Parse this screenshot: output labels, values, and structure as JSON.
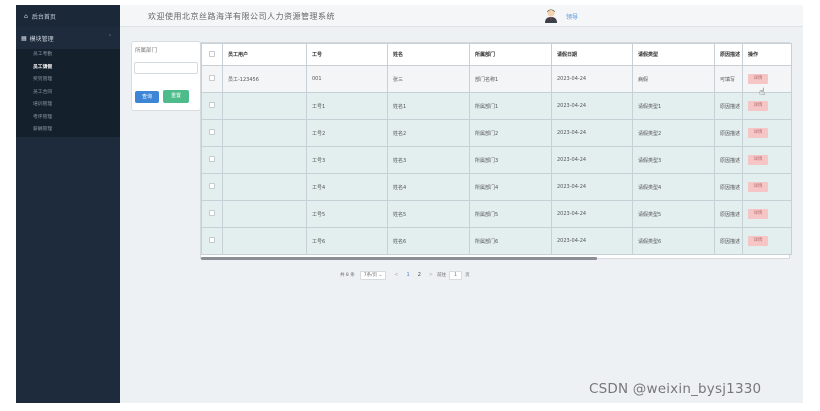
{
  "sidebar": {
    "home": "后台首页",
    "group": "模块管理",
    "items": [
      {
        "label": "员工考勤"
      },
      {
        "label": "员工请假"
      },
      {
        "label": "奖罚管理"
      },
      {
        "label": "员工合同"
      },
      {
        "label": "培训管理"
      },
      {
        "label": "考评管理"
      },
      {
        "label": "薪酬管理"
      }
    ]
  },
  "header": {
    "title": "欢迎使用北京丝路海洋有限公司人力资源管理系统",
    "role": "领导"
  },
  "search": {
    "label": "所属部门",
    "query_button": "查询",
    "reset_button": "重置"
  },
  "table": {
    "columns": [
      "员工用户",
      "工号",
      "姓名",
      "所属部门",
      "请假日期",
      "请假类型",
      "原因描述",
      "操作"
    ],
    "rows": [
      {
        "user": "员工-123456",
        "id": "001",
        "name": "张三",
        "dept": "部门名称1",
        "date": "2023-04-24",
        "type": "病假",
        "reason": "可填写",
        "action": "详情"
      },
      {
        "user": "",
        "id": "工号1",
        "name": "姓名1",
        "dept": "所属部门1",
        "date": "2023-04-24",
        "type": "请假类型1",
        "reason": "原因描述",
        "action": "详情"
      },
      {
        "user": "",
        "id": "工号2",
        "name": "姓名2",
        "dept": "所属部门2",
        "date": "2023-04-24",
        "type": "请假类型2",
        "reason": "原因描述",
        "action": "详情"
      },
      {
        "user": "",
        "id": "工号3",
        "name": "姓名3",
        "dept": "所属部门3",
        "date": "2023-04-24",
        "type": "请假类型3",
        "reason": "原因描述",
        "action": "详情"
      },
      {
        "user": "",
        "id": "工号4",
        "name": "姓名4",
        "dept": "所属部门4",
        "date": "2023-04-24",
        "type": "请假类型4",
        "reason": "原因描述",
        "action": "详情"
      },
      {
        "user": "",
        "id": "工号5",
        "name": "姓名5",
        "dept": "所属部门5",
        "date": "2023-04-24",
        "type": "请假类型5",
        "reason": "原因描述",
        "action": "详情"
      },
      {
        "user": "",
        "id": "工号6",
        "name": "姓名6",
        "dept": "所属部门6",
        "date": "2023-04-24",
        "type": "请假类型6",
        "reason": "原因描述",
        "action": "详情"
      }
    ]
  },
  "pager": {
    "total": "共 8 条",
    "page_size": "7条/页",
    "prev": "<",
    "pages": [
      "1",
      "2"
    ],
    "next": ">",
    "goto_label": "前往",
    "goto_value": "1",
    "goto_unit": "页"
  },
  "watermark": "CSDN @weixin_bysj1330",
  "colors": {
    "sidebar_bg": "#1d2b3c",
    "primary": "#3d86d6",
    "success": "#4dbb8a",
    "row_highlight": "#e3eeee",
    "detail_button": "#f6c6c6"
  }
}
